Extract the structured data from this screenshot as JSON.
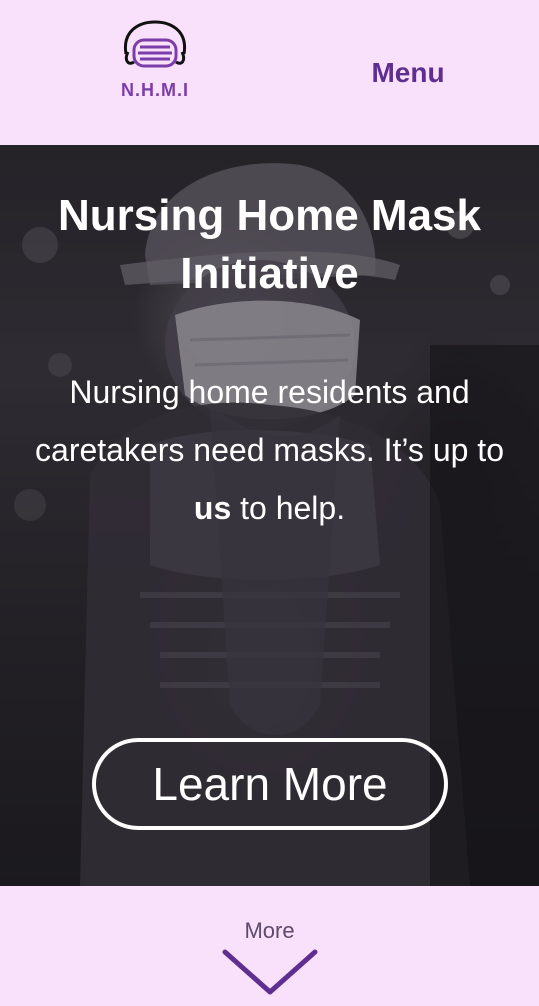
{
  "header": {
    "logo_text": "N.H.M.I",
    "logo_icon": "face-mask-icon",
    "menu_label": "Menu"
  },
  "hero": {
    "title": "Nursing Home Mask Initiative",
    "subtitle_before": "Nursing home residents and caretakers need masks. It’s up to ",
    "subtitle_bold": "us",
    "subtitle_after": " to help.",
    "cta_label": "Learn More"
  },
  "footer": {
    "more_label": "More",
    "more_icon": "chevron-down-icon"
  },
  "colors": {
    "brand_background": "#f9e0fb",
    "brand_purple": "#5e2e91",
    "logo_purple": "#7b3ea8",
    "hero_text": "#ffffff"
  }
}
